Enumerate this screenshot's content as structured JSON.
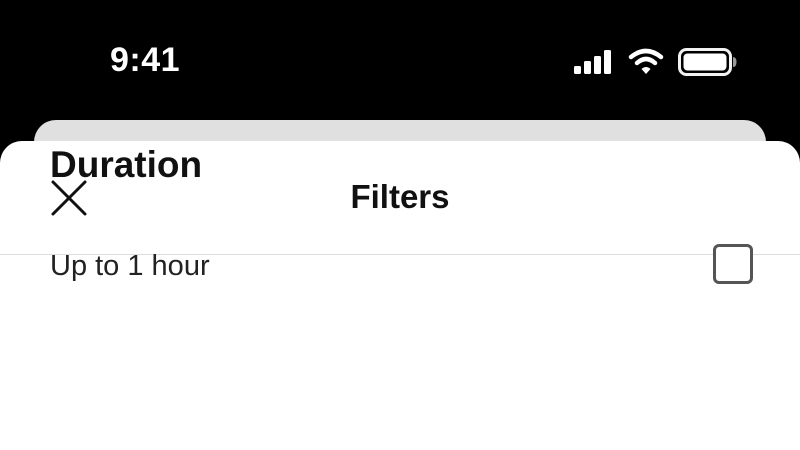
{
  "status_bar": {
    "time": "9:41",
    "icons": [
      "cellular-signal-icon",
      "wifi-icon",
      "battery-icon"
    ]
  },
  "sheet": {
    "title": "Filters",
    "close_icon": "close-icon"
  },
  "sections": [
    {
      "title": "Duration",
      "options": [
        {
          "label": "Up to 1 hour",
          "checked": false
        }
      ]
    }
  ],
  "colors": {
    "background": "#000000",
    "sheet": "#ffffff",
    "back_card": "#e0e0e0",
    "text": "#111111",
    "divider": "#dcdcdc",
    "checkbox_border": "#555555"
  }
}
